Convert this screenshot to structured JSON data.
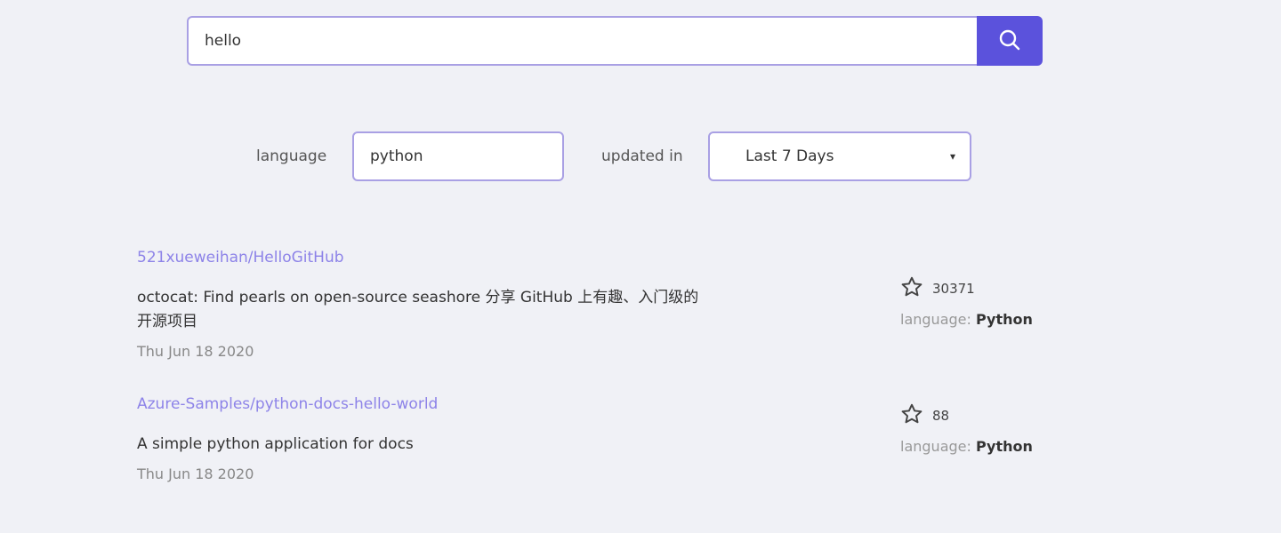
{
  "search": {
    "query": "hello",
    "button_icon": "search-icon"
  },
  "filters": {
    "language_label": "language",
    "language_value": "python",
    "updated_label": "updated in",
    "updated_value": "Last 7 Days"
  },
  "results": [
    {
      "name": "521xueweihan/HelloGitHub",
      "description": "octocat: Find pearls on open-source seashore 分享 GitHub 上有趣、入门级的开源项目",
      "date": "Thu Jun 18 2020",
      "stars": "30371",
      "language_label": "language:",
      "language": "Python"
    },
    {
      "name": "Azure-Samples/python-docs-hello-world",
      "description": "A simple python application for docs",
      "date": "Thu Jun 18 2020",
      "stars": "88",
      "language_label": "language:",
      "language": "Python"
    }
  ],
  "icons": {
    "search": "search-icon",
    "star": "star-icon",
    "chevron": "chevron-down-icon"
  },
  "colors": {
    "accent": "#5b52dc",
    "link": "#8d83e8",
    "border": "#a9a0e4",
    "background": "#f0f1f6"
  }
}
